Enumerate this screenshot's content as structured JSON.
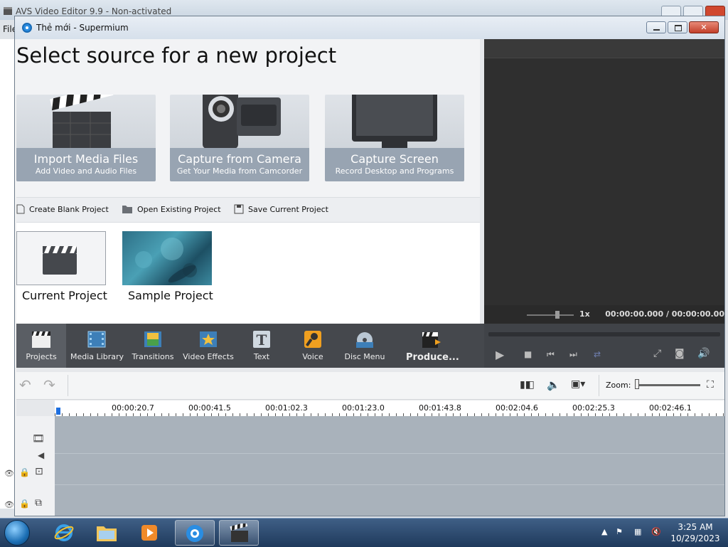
{
  "bg_app": {
    "title": "AVS Video Editor 9.9 - Non-activated",
    "menu_first": "File"
  },
  "browser": {
    "title": "Thẻ mới - Supermium"
  },
  "start_panel": {
    "heading": "Select source for a new project",
    "cards": [
      {
        "title": "Import Media Files",
        "subtitle": "Add Video and Audio Files"
      },
      {
        "title": "Capture from Camera",
        "subtitle": "Get Your Media from Camcorder"
      },
      {
        "title": "Capture Screen",
        "subtitle": "Record Desktop and Programs"
      }
    ],
    "actions": [
      "Create Blank Project",
      "Open Existing Project",
      "Save Current Project"
    ],
    "recent": [
      "Current Project",
      "Sample Project"
    ]
  },
  "preview": {
    "speed": "1x",
    "time": "00:00:00.000  /  00:00:00.00"
  },
  "toolbar": {
    "tools": [
      "Projects",
      "Media Library",
      "Transitions",
      "Video Effects",
      "Text",
      "Voice",
      "Disc Menu",
      "Produce..."
    ]
  },
  "timeline": {
    "zoom_label": "Zoom:",
    "ruler": [
      "00:00:20.7",
      "00:00:41.5",
      "00:01:02.3",
      "00:01:23.0",
      "00:01:43.8",
      "00:02:04.6",
      "00:02:25.3",
      "00:02:46.1"
    ]
  },
  "taskbar": {
    "time": "3:25 AM",
    "date": "10/29/2023"
  },
  "colors": {
    "toolbar_bg": "#45484d",
    "preview_bg": "#2f2f2f",
    "card_lower": "#98a4b2",
    "track_bg": "#a9b2bb",
    "accent_blue": "#1e6fe0"
  }
}
